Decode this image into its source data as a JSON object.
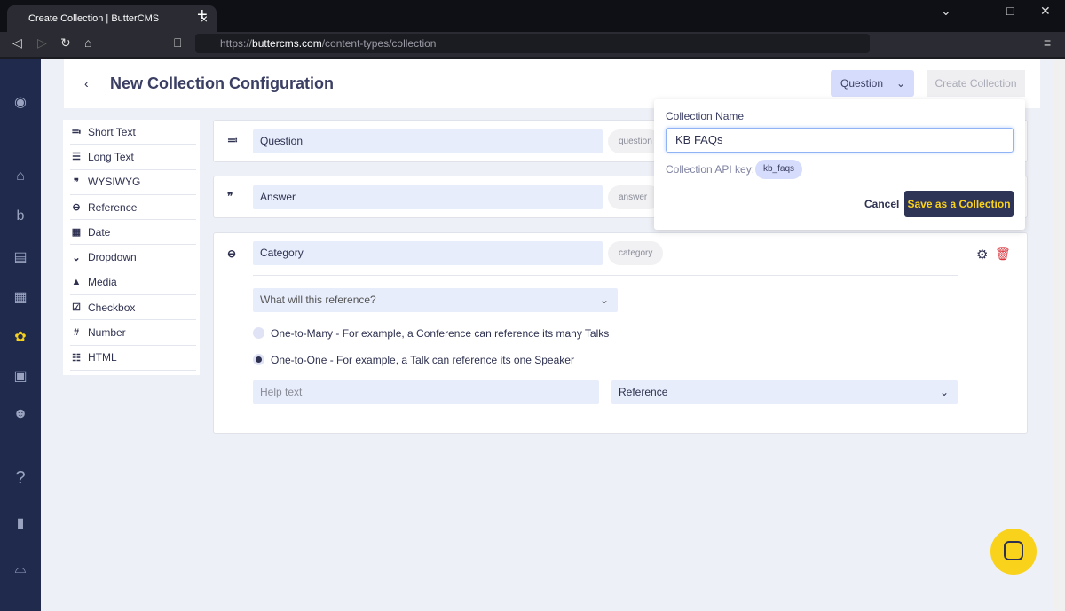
{
  "browser": {
    "tab_title": "Create Collection | ButterCMS",
    "url_prefix": "https://",
    "url_domain": "buttercms.com",
    "url_path": "/content-types/collection"
  },
  "header": {
    "title": "New Collection Configuration",
    "type_select": "Question",
    "create_button": "Create Collection"
  },
  "field_types": [
    {
      "icon": "≕",
      "label": "Short Text"
    },
    {
      "icon": "☰",
      "label": "Long Text"
    },
    {
      "icon": "❞",
      "label": "WYSIWYG"
    },
    {
      "icon": "⊖",
      "label": "Reference"
    },
    {
      "icon": "▦",
      "label": "Date"
    },
    {
      "icon": "⌄",
      "label": "Dropdown"
    },
    {
      "icon": "▲",
      "label": "Media"
    },
    {
      "icon": "☑",
      "label": "Checkbox"
    },
    {
      "icon": "#",
      "label": "Number"
    },
    {
      "icon": "☷",
      "label": "HTML"
    }
  ],
  "fields": [
    {
      "icon": "≕",
      "name": "Question",
      "key": "question"
    },
    {
      "icon": "❞",
      "name": "Answer",
      "key": "answer"
    },
    {
      "icon": "⊖",
      "name": "Category",
      "key": "category"
    }
  ],
  "reference": {
    "select_placeholder": "What will this reference?",
    "option_many": "One-to-Many - For example, a Conference can reference its many Talks",
    "option_one": "One-to-One - For example, a Talk can reference its one Speaker",
    "selected": "one",
    "help_placeholder": "Help text",
    "type_select": "Reference"
  },
  "popup": {
    "label": "Collection Name",
    "value": "KB FAQs",
    "api_key_label": "Collection API key:",
    "api_key": "kb_faqs",
    "cancel": "Cancel",
    "save": "Save as a Collection"
  },
  "colors": {
    "navy": "#1f2a4d",
    "accent_yellow": "#f9d21c",
    "delete_red": "#d9363e"
  }
}
